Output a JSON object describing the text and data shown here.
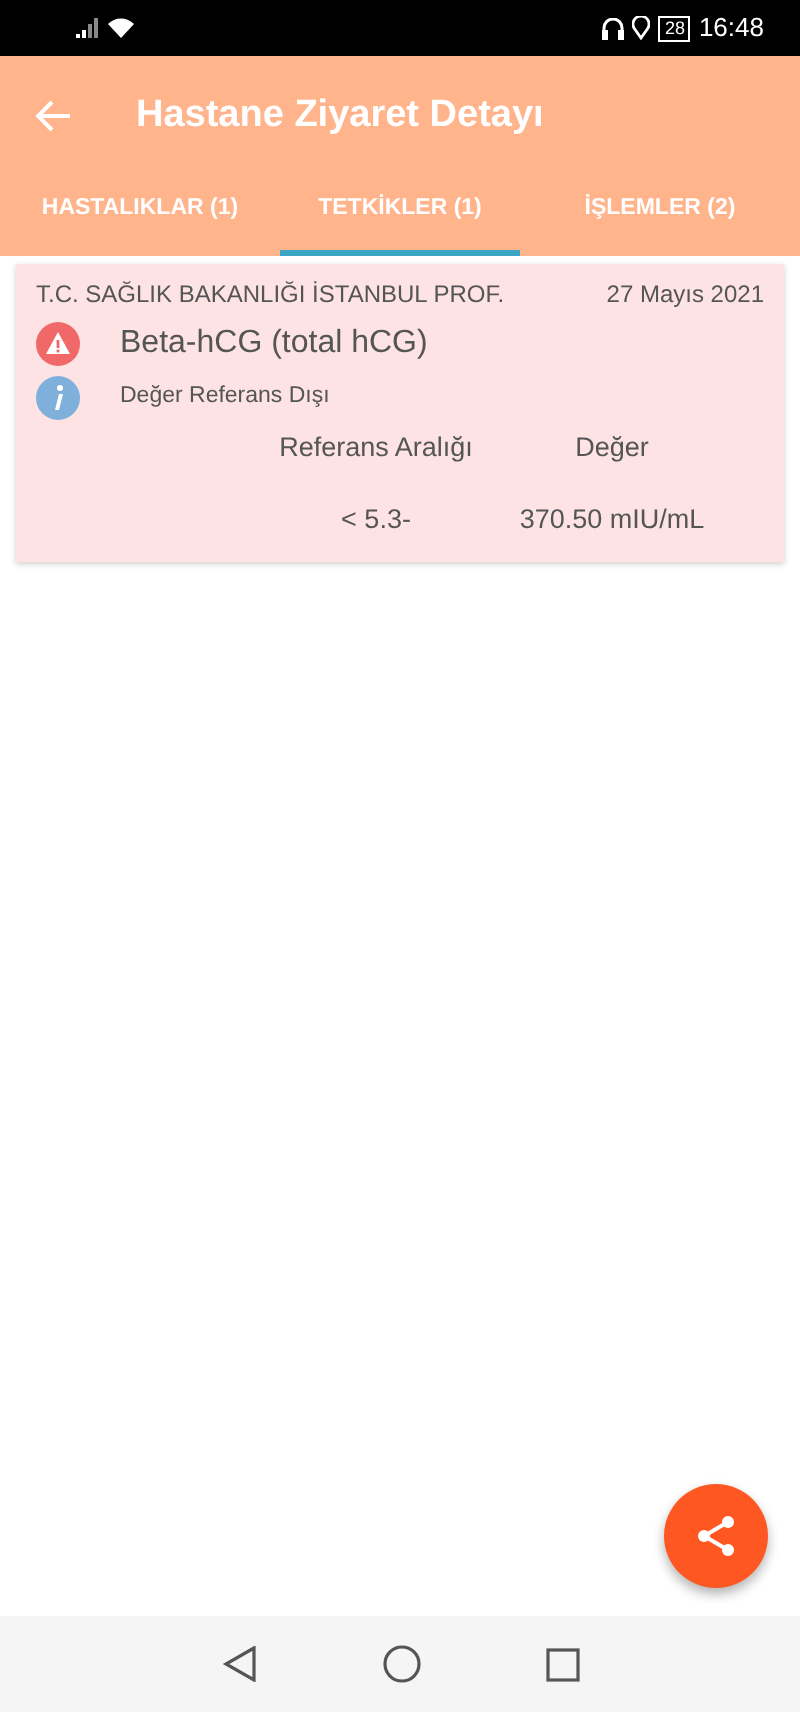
{
  "status_bar": {
    "battery": "28",
    "time": "16:48"
  },
  "app_bar": {
    "title": "Hastane Ziyaret Detayı"
  },
  "tabs": [
    {
      "label": "HASTALIKLAR (1)",
      "selected": false
    },
    {
      "label": "TETKİKLER (1)",
      "selected": true
    },
    {
      "label": "İŞLEMLER (2)",
      "selected": false
    }
  ],
  "results": [
    {
      "institution": "T.C. SAĞLIK BAKANLIĞI  İSTANBUL PROF.",
      "date": "27 Mayıs 2021",
      "test": "Beta-hCG (total hCG)",
      "note": "Değer Referans Dışı",
      "out_of_range": true,
      "range_label": "Referans Aralığı",
      "value_label": "Değer",
      "range": "< 5.3-",
      "value": "370.50 mIU/mL"
    }
  ]
}
